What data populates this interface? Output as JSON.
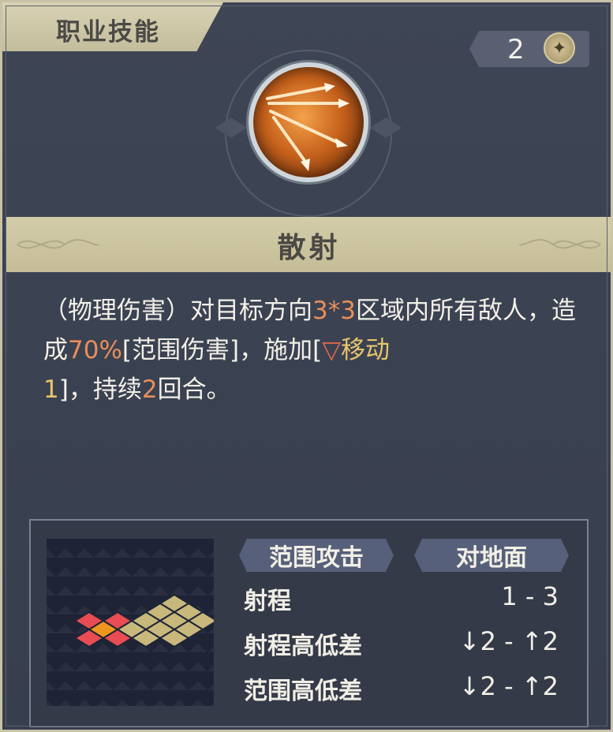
{
  "header": {
    "title": "职业技能"
  },
  "cost": {
    "value": "2",
    "icon": "star-coin-icon"
  },
  "skill": {
    "name": "散射",
    "icon": "scatter-arrows-icon",
    "desc": {
      "p1": "（物理伤害）对目标方向",
      "v1": "3*3",
      "p2": "区域内所有敌人，造成",
      "v2": "70%",
      "p3": "[范围伤害]，施加[",
      "status_name": "移动",
      "status_level": "1",
      "p4": "]，持续",
      "v3": "2",
      "p5": "回合。"
    }
  },
  "tags": {
    "attack_type": "范围攻击",
    "target": "对地面"
  },
  "stats": [
    {
      "label": "射程",
      "value": "1 - 3"
    },
    {
      "label": "射程高低差",
      "value": "↓2 - ↑2"
    },
    {
      "label": "范围高低差",
      "value": "↓2 - ↑2"
    }
  ],
  "colors": {
    "highlight": "#e98e5a",
    "status": "#e8c46c",
    "grid_tile": "#c8b87c",
    "grid_center": "#f0961e",
    "grid_enemy": "#e94c52"
  }
}
